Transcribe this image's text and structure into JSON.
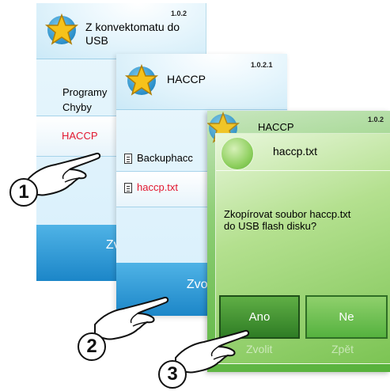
{
  "screen1": {
    "version": "1.0.2",
    "title": "Z konvektomatu do USB",
    "menu": [
      "Programy",
      "Chyby",
      "HACCP"
    ],
    "button": "Zvolit"
  },
  "screen2": {
    "version": "1.0.2.1",
    "title": "HACCP",
    "files": [
      "Backuphacc",
      "haccp.txt"
    ],
    "button": "Zvolit"
  },
  "screen3": {
    "version": "1.0.2",
    "title": "HACCP",
    "dialog_title": "haccp.txt",
    "message_line1": "Zkopírovat soubor haccp.txt",
    "message_line2": "do USB flash disku?",
    "yes": "Ano",
    "no": "Ne",
    "behind_left": "Zvolit",
    "behind_right": "Zpět"
  },
  "steps": [
    "1",
    "2",
    "3"
  ],
  "colors": {
    "highlight": "#e2172f",
    "blue_button": "#1c86c8",
    "green_button": "#2f7d25"
  },
  "icons": [
    "star-icon",
    "file-icon",
    "pointing-hand-icon"
  ]
}
